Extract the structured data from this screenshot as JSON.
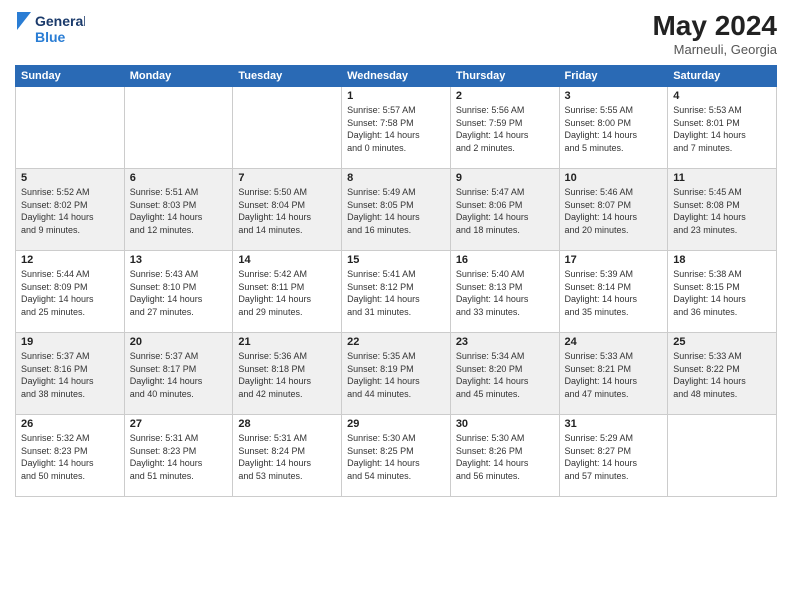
{
  "header": {
    "logo_line1": "General",
    "logo_line2": "Blue",
    "month": "May 2024",
    "location": "Marneuli, Georgia"
  },
  "weekdays": [
    "Sunday",
    "Monday",
    "Tuesday",
    "Wednesday",
    "Thursday",
    "Friday",
    "Saturday"
  ],
  "weeks": [
    [
      {
        "day": "",
        "info": ""
      },
      {
        "day": "",
        "info": ""
      },
      {
        "day": "",
        "info": ""
      },
      {
        "day": "1",
        "info": "Sunrise: 5:57 AM\nSunset: 7:58 PM\nDaylight: 14 hours\nand 0 minutes."
      },
      {
        "day": "2",
        "info": "Sunrise: 5:56 AM\nSunset: 7:59 PM\nDaylight: 14 hours\nand 2 minutes."
      },
      {
        "day": "3",
        "info": "Sunrise: 5:55 AM\nSunset: 8:00 PM\nDaylight: 14 hours\nand 5 minutes."
      },
      {
        "day": "4",
        "info": "Sunrise: 5:53 AM\nSunset: 8:01 PM\nDaylight: 14 hours\nand 7 minutes."
      }
    ],
    [
      {
        "day": "5",
        "info": "Sunrise: 5:52 AM\nSunset: 8:02 PM\nDaylight: 14 hours\nand 9 minutes."
      },
      {
        "day": "6",
        "info": "Sunrise: 5:51 AM\nSunset: 8:03 PM\nDaylight: 14 hours\nand 12 minutes."
      },
      {
        "day": "7",
        "info": "Sunrise: 5:50 AM\nSunset: 8:04 PM\nDaylight: 14 hours\nand 14 minutes."
      },
      {
        "day": "8",
        "info": "Sunrise: 5:49 AM\nSunset: 8:05 PM\nDaylight: 14 hours\nand 16 minutes."
      },
      {
        "day": "9",
        "info": "Sunrise: 5:47 AM\nSunset: 8:06 PM\nDaylight: 14 hours\nand 18 minutes."
      },
      {
        "day": "10",
        "info": "Sunrise: 5:46 AM\nSunset: 8:07 PM\nDaylight: 14 hours\nand 20 minutes."
      },
      {
        "day": "11",
        "info": "Sunrise: 5:45 AM\nSunset: 8:08 PM\nDaylight: 14 hours\nand 23 minutes."
      }
    ],
    [
      {
        "day": "12",
        "info": "Sunrise: 5:44 AM\nSunset: 8:09 PM\nDaylight: 14 hours\nand 25 minutes."
      },
      {
        "day": "13",
        "info": "Sunrise: 5:43 AM\nSunset: 8:10 PM\nDaylight: 14 hours\nand 27 minutes."
      },
      {
        "day": "14",
        "info": "Sunrise: 5:42 AM\nSunset: 8:11 PM\nDaylight: 14 hours\nand 29 minutes."
      },
      {
        "day": "15",
        "info": "Sunrise: 5:41 AM\nSunset: 8:12 PM\nDaylight: 14 hours\nand 31 minutes."
      },
      {
        "day": "16",
        "info": "Sunrise: 5:40 AM\nSunset: 8:13 PM\nDaylight: 14 hours\nand 33 minutes."
      },
      {
        "day": "17",
        "info": "Sunrise: 5:39 AM\nSunset: 8:14 PM\nDaylight: 14 hours\nand 35 minutes."
      },
      {
        "day": "18",
        "info": "Sunrise: 5:38 AM\nSunset: 8:15 PM\nDaylight: 14 hours\nand 36 minutes."
      }
    ],
    [
      {
        "day": "19",
        "info": "Sunrise: 5:37 AM\nSunset: 8:16 PM\nDaylight: 14 hours\nand 38 minutes."
      },
      {
        "day": "20",
        "info": "Sunrise: 5:37 AM\nSunset: 8:17 PM\nDaylight: 14 hours\nand 40 minutes."
      },
      {
        "day": "21",
        "info": "Sunrise: 5:36 AM\nSunset: 8:18 PM\nDaylight: 14 hours\nand 42 minutes."
      },
      {
        "day": "22",
        "info": "Sunrise: 5:35 AM\nSunset: 8:19 PM\nDaylight: 14 hours\nand 44 minutes."
      },
      {
        "day": "23",
        "info": "Sunrise: 5:34 AM\nSunset: 8:20 PM\nDaylight: 14 hours\nand 45 minutes."
      },
      {
        "day": "24",
        "info": "Sunrise: 5:33 AM\nSunset: 8:21 PM\nDaylight: 14 hours\nand 47 minutes."
      },
      {
        "day": "25",
        "info": "Sunrise: 5:33 AM\nSunset: 8:22 PM\nDaylight: 14 hours\nand 48 minutes."
      }
    ],
    [
      {
        "day": "26",
        "info": "Sunrise: 5:32 AM\nSunset: 8:23 PM\nDaylight: 14 hours\nand 50 minutes."
      },
      {
        "day": "27",
        "info": "Sunrise: 5:31 AM\nSunset: 8:23 PM\nDaylight: 14 hours\nand 51 minutes."
      },
      {
        "day": "28",
        "info": "Sunrise: 5:31 AM\nSunset: 8:24 PM\nDaylight: 14 hours\nand 53 minutes."
      },
      {
        "day": "29",
        "info": "Sunrise: 5:30 AM\nSunset: 8:25 PM\nDaylight: 14 hours\nand 54 minutes."
      },
      {
        "day": "30",
        "info": "Sunrise: 5:30 AM\nSunset: 8:26 PM\nDaylight: 14 hours\nand 56 minutes."
      },
      {
        "day": "31",
        "info": "Sunrise: 5:29 AM\nSunset: 8:27 PM\nDaylight: 14 hours\nand 57 minutes."
      },
      {
        "day": "",
        "info": ""
      }
    ]
  ]
}
